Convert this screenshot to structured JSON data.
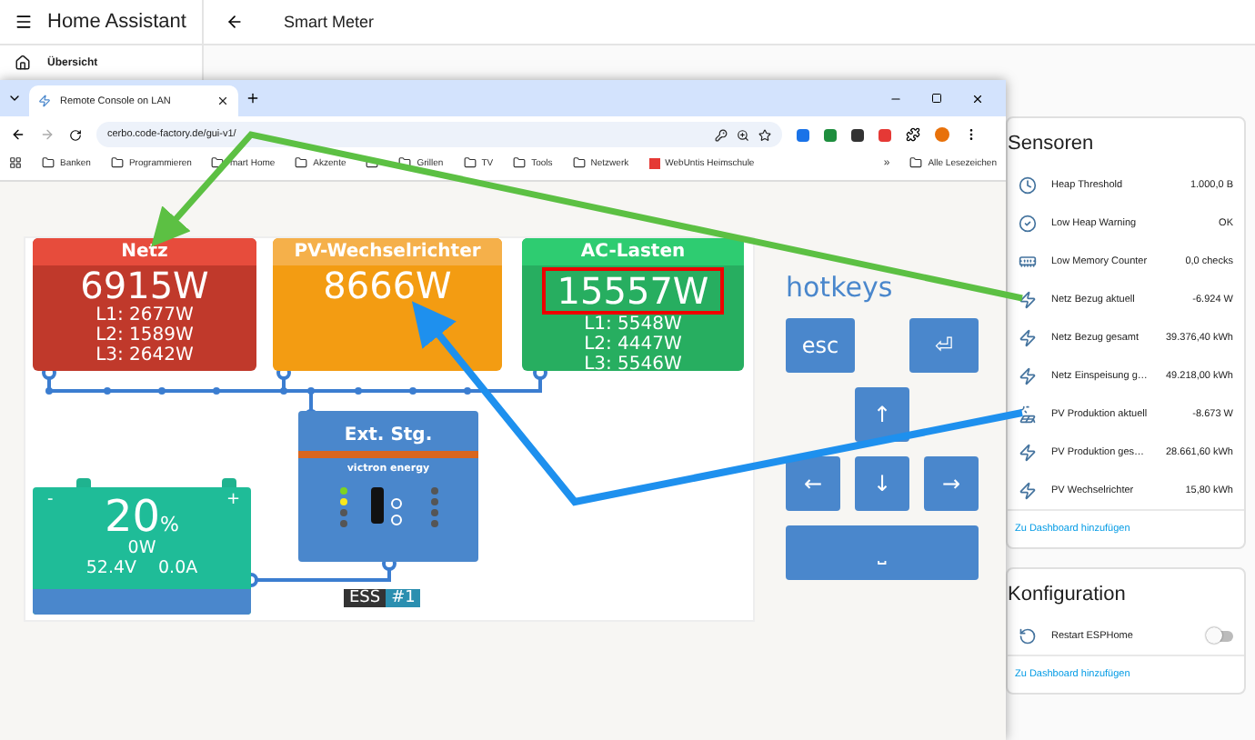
{
  "app": {
    "title": "Home Assistant",
    "page_title": "Smart Meter"
  },
  "sidebar": {
    "items": [
      {
        "label": "Übersicht"
      }
    ]
  },
  "browser": {
    "tab_title": "Remote Console on LAN",
    "url": "cerbo.code-factory.de/gui-v1/",
    "bookmarks": [
      {
        "kind": "folder",
        "label": "Banken"
      },
      {
        "kind": "folder",
        "label": "Programmieren"
      },
      {
        "kind": "folder",
        "label": "mart Home"
      },
      {
        "kind": "folder",
        "label": "Akzente"
      },
      {
        "kind": "folder"
      },
      {
        "kind": "folder",
        "label": "Grillen"
      },
      {
        "kind": "folder",
        "label": "TV"
      },
      {
        "kind": "folder",
        "label": "Tools"
      },
      {
        "kind": "folder",
        "label": "Netzwerk"
      },
      {
        "kind": "site",
        "label": "WebUntis Heimschule"
      }
    ],
    "more": "»",
    "all_bookmarks": "Alle Lesezeichen"
  },
  "victron": {
    "grid": {
      "title": "Netz",
      "power": "6915W",
      "phases": [
        "L1: 2677W",
        "L2: 1589W",
        "L3: 2642W"
      ]
    },
    "pv": {
      "title": "PV-Wechselrichter",
      "power": "8666W"
    },
    "loads": {
      "title": "AC-Lasten",
      "power": "15557W",
      "phases": [
        "L1: 5548W",
        "L2: 4447W",
        "L3: 5546W"
      ],
      "highlighted": true
    },
    "battery": {
      "soc": "20",
      "unit": "%",
      "power": "0W",
      "voltage": "52.4V",
      "current": "0.0A",
      "minus": "-",
      "plus": "+"
    },
    "inverter": {
      "title": "Ext. Stg.",
      "brand": "victron energy"
    },
    "ess": {
      "label": "ESS",
      "number": "#1"
    }
  },
  "hotkeys": {
    "title": "hotkeys",
    "keys": [
      {
        "kind": "esc",
        "label": "esc"
      },
      {
        "kind": "enter",
        "label": "⏎"
      },
      {
        "kind": "up",
        "label": "↑"
      },
      {
        "kind": "left",
        "label": "←"
      },
      {
        "kind": "down",
        "label": "↓"
      },
      {
        "kind": "right",
        "label": "→"
      },
      {
        "kind": "space",
        "label": "⎵"
      }
    ]
  },
  "cards": [
    {
      "title": "Sensoren",
      "rows": [
        {
          "kind": "clock",
          "name": "Heap Threshold",
          "value": "1.000,0 B"
        },
        {
          "kind": "check",
          "name": "Low Heap Warning",
          "value": "OK"
        },
        {
          "kind": "memory",
          "name": "Low Memory Counter",
          "value": "0,0 checks"
        },
        {
          "kind": "energy",
          "name": "Netz Bezug aktuell",
          "value": "-6.924 W"
        },
        {
          "kind": "energy",
          "name": "Netz Bezug gesamt",
          "value": "39.376,40 kWh"
        },
        {
          "kind": "energy",
          "name": "Netz Einspeisung g…",
          "value": "49.218,00 kWh"
        },
        {
          "kind": "solar",
          "name": "PV Produktion aktuell",
          "value": "-8.673 W"
        },
        {
          "kind": "energy",
          "name": "PV Produktion ges…",
          "value": "28.661,60 kWh"
        },
        {
          "kind": "energy",
          "name": "PV Wechselrichter",
          "value": "15,80 kWh"
        }
      ],
      "link": "Zu Dashboard hinzufügen"
    },
    {
      "title": "Konfiguration",
      "rows": [
        {
          "kind": "switch",
          "name": "Restart ESPHome",
          "on": false
        }
      ],
      "link": "Zu Dashboard hinzufügen"
    }
  ]
}
